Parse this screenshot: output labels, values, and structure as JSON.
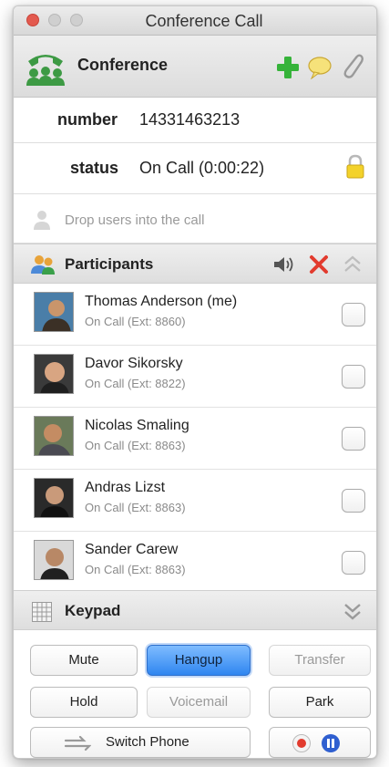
{
  "window": {
    "title": "Conference Call"
  },
  "header": {
    "title": "Conference",
    "add_icon": "plus-icon",
    "chat_icon": "chat-bubble-icon",
    "attach_icon": "paperclip-icon"
  },
  "fields": {
    "number": {
      "label": "number",
      "value": "14331463213"
    },
    "status": {
      "label": "status",
      "value": "On Call (0:00:22)"
    }
  },
  "drop_zone": {
    "text": "Drop users into the call"
  },
  "participants_section": {
    "title": "Participants"
  },
  "participants": [
    {
      "name": "Thomas Anderson (me)",
      "status": "On Call (Ext: 8860)",
      "checked": false
    },
    {
      "name": "Davor Sikorsky",
      "status": "On Call (Ext: 8822)",
      "checked": false
    },
    {
      "name": "Nicolas Smaling",
      "status": "On Call (Ext: 8863)",
      "checked": false
    },
    {
      "name": "Andras Lizst",
      "status": "On Call (Ext: 8863)",
      "checked": false
    },
    {
      "name": "Sander Carew",
      "status": "On Call (Ext: 8863)",
      "checked": false
    }
  ],
  "keypad_section": {
    "title": "Keypad"
  },
  "buttons": {
    "mute": "Mute",
    "hangup": "Hangup",
    "transfer": "Transfer",
    "hold": "Hold",
    "voicemail": "Voicemail",
    "park": "Park",
    "switch_phone": "Switch Phone"
  },
  "colors": {
    "accent": "#2f86f0",
    "close_red": "#e35a4f",
    "add_green": "#36b33a",
    "remove_red": "#e23b2e"
  }
}
